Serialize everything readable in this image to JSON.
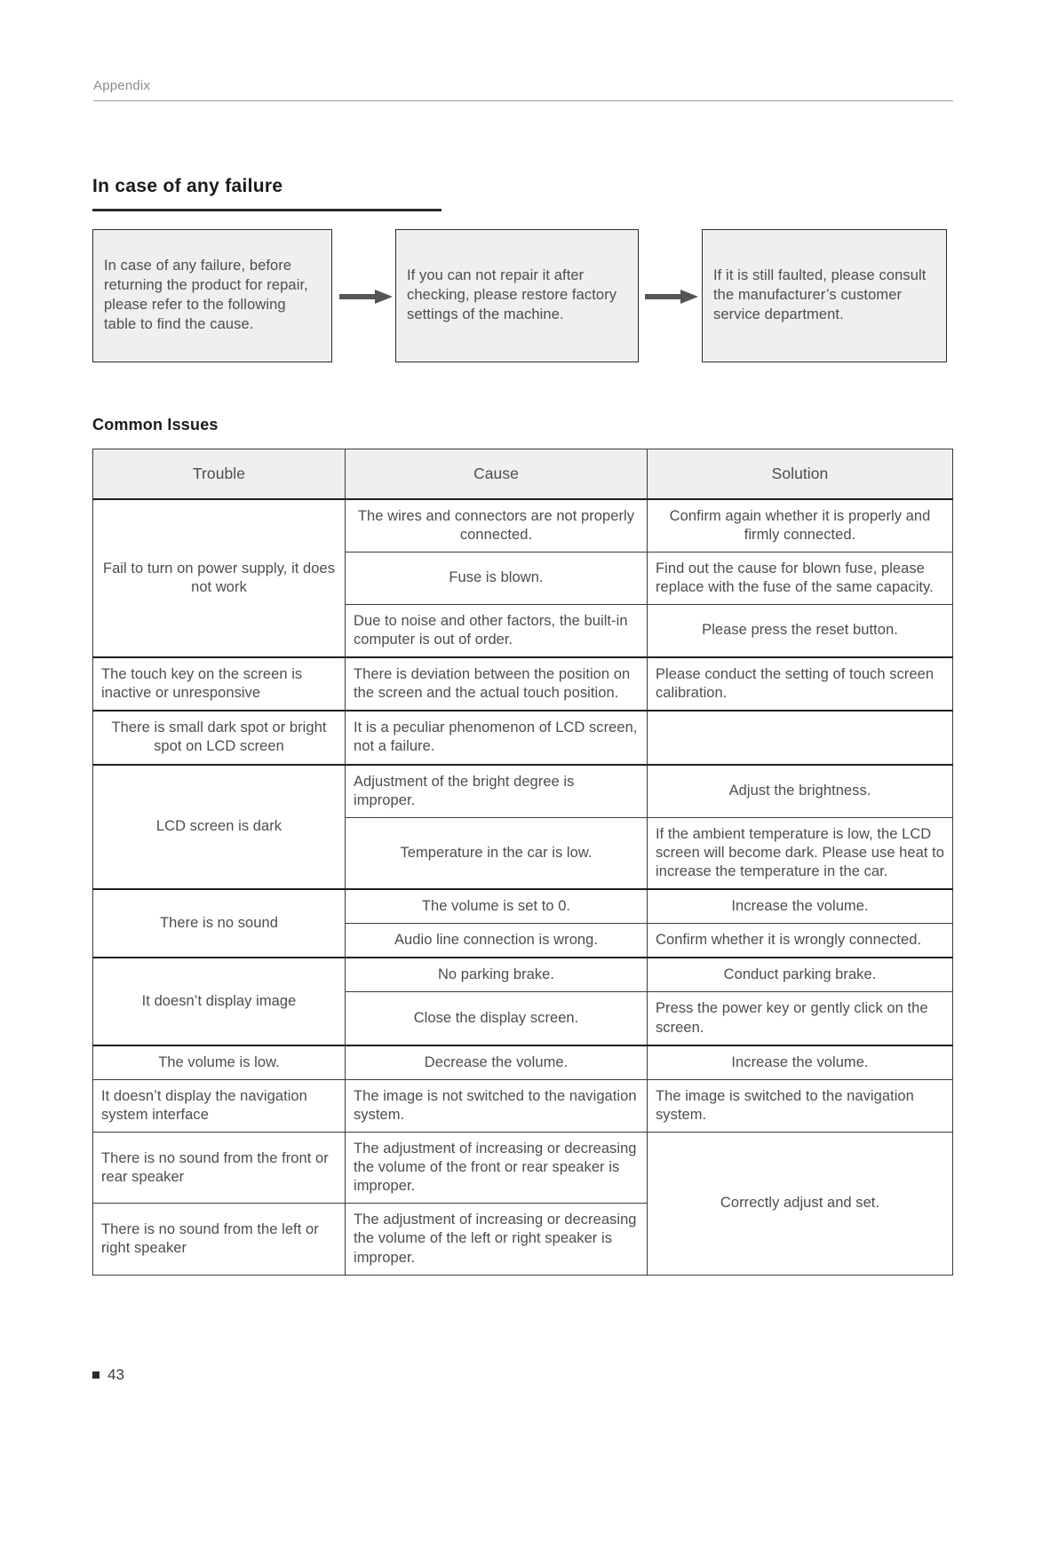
{
  "header": {
    "running_label": "Appendix"
  },
  "section": {
    "title": "In case of any failure"
  },
  "flow": {
    "steps": [
      "In case of any failure, before returning the product for repair, please refer to the following table to find the cause.",
      "If you can not repair it after checking, please restore factory settings of the machine.",
      "If it is still faulted, please consult the manufacturer’s customer service department."
    ],
    "arrow_icon": "right-arrow-icon"
  },
  "subsection": {
    "title": "Common Issues"
  },
  "table": {
    "columns": [
      "Trouble",
      "Cause",
      "Solution"
    ],
    "rows": [
      {
        "trouble": "Fail to turn on power supply, it does not work",
        "trouble_rowspan": 3,
        "group_start": true,
        "cause": "The wires and connectors are not properly connected.",
        "cause_align": "center",
        "solution": "Confirm again whether it is properly and firmly connected.",
        "solution_align": "center"
      },
      {
        "cause": "Fuse is blown.",
        "cause_align": "center",
        "solution": "Find out the cause for blown fuse, please replace with the fuse of the same capacity.",
        "solution_align": "left"
      },
      {
        "cause": "Due to noise and other factors, the built-in computer is out of order.",
        "cause_align": "left",
        "solution": "Please press the reset button.",
        "solution_align": "center"
      },
      {
        "trouble": "The touch key on the screen is inactive or unresponsive",
        "trouble_rowspan": 1,
        "group_start": true,
        "trouble_align": "left",
        "cause": "There is deviation between the position on the screen and the actual touch position.",
        "cause_align": "left",
        "solution": "Please conduct the setting of touch screen calibration.",
        "solution_align": "left"
      },
      {
        "trouble": "There is small dark spot or bright spot on LCD screen",
        "trouble_rowspan": 1,
        "group_start": true,
        "cause": "It is a peculiar phenomenon of LCD screen, not a failure.",
        "cause_align": "left",
        "solution": "",
        "solution_align": "center"
      },
      {
        "trouble": "LCD screen is dark",
        "trouble_rowspan": 2,
        "group_start": true,
        "cause": "Adjustment of the bright degree is improper.",
        "cause_align": "left",
        "solution": "Adjust the brightness.",
        "solution_align": "center"
      },
      {
        "cause": "Temperature in the car is low.",
        "cause_align": "center",
        "solution": "If the ambient temperature is low, the LCD screen will become dark. Please use heat to increase the temperature in the car.",
        "solution_align": "left"
      },
      {
        "trouble": "There is no sound",
        "trouble_rowspan": 2,
        "group_start": true,
        "cause": "The volume is set to 0.",
        "cause_align": "center",
        "solution": "Increase the volume.",
        "solution_align": "center"
      },
      {
        "cause": "Audio line connection is wrong.",
        "cause_align": "center",
        "solution": "Confirm whether it is wrongly connected.",
        "solution_align": "left"
      },
      {
        "trouble": "It doesn’t display image",
        "trouble_rowspan": 2,
        "group_start": true,
        "cause": "No parking brake.",
        "cause_align": "center",
        "solution": "Conduct parking brake.",
        "solution_align": "center"
      },
      {
        "cause": "Close the display screen.",
        "cause_align": "center",
        "solution": "Press the power key or gently click on the screen.",
        "solution_align": "left"
      },
      {
        "trouble": "The volume is low.",
        "trouble_rowspan": 1,
        "group_start": true,
        "cause": "Decrease the volume.",
        "cause_align": "center",
        "solution": "Increase the volume.",
        "solution_align": "center"
      },
      {
        "trouble": "It doesn’t display the navigation system interface",
        "trouble_rowspan": 1,
        "group_start": false,
        "trouble_align": "left",
        "cause": "The image is not switched to the navigation system.",
        "cause_align": "left",
        "solution": "The image is switched to the navigation system.",
        "solution_align": "left"
      },
      {
        "trouble": "There is no sound from the front or rear speaker",
        "trouble_rowspan": 1,
        "group_start": false,
        "trouble_align": "left",
        "cause": "The adjustment of increasing or decreasing the volume of the front or rear speaker is improper.",
        "cause_align": "left",
        "solution": "Correctly adjust and set.",
        "solution_rowspan": 2,
        "solution_align": "center"
      },
      {
        "trouble": "There is no sound from the left or right speaker",
        "trouble_rowspan": 1,
        "group_start": false,
        "trouble_align": "left",
        "cause": "The adjustment of increasing or decreasing the volume of the left or right speaker is improper.",
        "cause_align": "left"
      }
    ]
  },
  "footer": {
    "page_number": "43",
    "marker_icon": "square-bullet-icon"
  }
}
